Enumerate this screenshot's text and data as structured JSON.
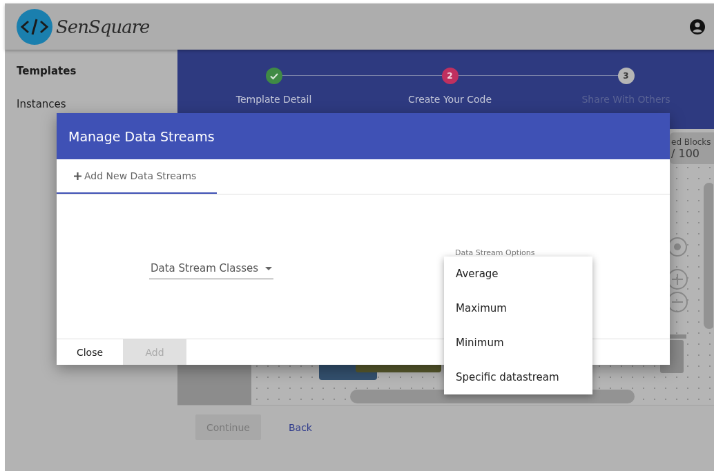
{
  "header": {
    "logo_text": "SenSquare"
  },
  "sidebar": {
    "items": [
      {
        "label": "Templates",
        "selected": true
      },
      {
        "label": "Instances",
        "selected": false
      }
    ]
  },
  "stepper": {
    "steps": [
      {
        "label": "Template Detail",
        "completed": true,
        "selected": false
      },
      {
        "number": "2",
        "label": "Create Your Code",
        "completed": false,
        "selected": true
      },
      {
        "number": "3",
        "label": "Share With Others",
        "completed": false,
        "selected": false
      }
    ]
  },
  "workspace": {
    "block_counter": {
      "label": "ed Blocks",
      "value": "/ 100"
    }
  },
  "actions": [
    {
      "label": "Continue",
      "kind": "raised",
      "disabled": true
    },
    {
      "label": "Back",
      "kind": "flat",
      "disabled": false
    }
  ],
  "dialog": {
    "title": "Manage Data Streams",
    "tabs": [
      {
        "label": "Add New Data Streams",
        "selected": true
      }
    ],
    "fields": [
      {
        "kind": "select",
        "value": "Data Stream Classes"
      },
      {
        "kind": "label",
        "label": "Data Stream Options"
      }
    ],
    "buttons": [
      {
        "label": "Close",
        "disabled": false
      },
      {
        "label": "Add",
        "disabled": true
      }
    ]
  },
  "menu": {
    "options": [
      {
        "label": "Average"
      },
      {
        "label": "Maximum"
      },
      {
        "label": "Minimum"
      },
      {
        "label": "Specific datastream"
      }
    ]
  }
}
